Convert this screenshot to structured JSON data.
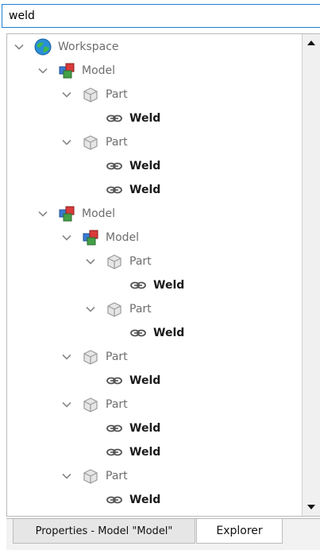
{
  "search": {
    "value": "weld"
  },
  "tabs": {
    "properties_label": "Properties - Model \"Model\"",
    "explorer_label": "Explorer"
  },
  "tree": [
    {
      "label": "Workspace",
      "type": "workspace",
      "depth": 0,
      "expandable": true
    },
    {
      "label": "Model",
      "type": "model",
      "depth": 1,
      "expandable": true
    },
    {
      "label": "Part",
      "type": "part",
      "depth": 2,
      "expandable": true
    },
    {
      "label": "Weld",
      "type": "weld",
      "depth": 3,
      "expandable": false
    },
    {
      "label": "Part",
      "type": "part",
      "depth": 2,
      "expandable": true
    },
    {
      "label": "Weld",
      "type": "weld",
      "depth": 3,
      "expandable": false
    },
    {
      "label": "Weld",
      "type": "weld",
      "depth": 3,
      "expandable": false
    },
    {
      "label": "Model",
      "type": "model",
      "depth": 1,
      "expandable": true
    },
    {
      "label": "Model",
      "type": "model",
      "depth": 2,
      "expandable": true
    },
    {
      "label": "Part",
      "type": "part",
      "depth": 3,
      "expandable": true
    },
    {
      "label": "Weld",
      "type": "weld",
      "depth": 4,
      "expandable": false
    },
    {
      "label": "Part",
      "type": "part",
      "depth": 3,
      "expandable": true
    },
    {
      "label": "Weld",
      "type": "weld",
      "depth": 4,
      "expandable": false
    },
    {
      "label": "Part",
      "type": "part",
      "depth": 2,
      "expandable": true
    },
    {
      "label": "Weld",
      "type": "weld",
      "depth": 3,
      "expandable": false
    },
    {
      "label": "Part",
      "type": "part",
      "depth": 2,
      "expandable": true
    },
    {
      "label": "Weld",
      "type": "weld",
      "depth": 3,
      "expandable": false
    },
    {
      "label": "Weld",
      "type": "weld",
      "depth": 3,
      "expandable": false
    },
    {
      "label": "Part",
      "type": "part",
      "depth": 2,
      "expandable": true
    },
    {
      "label": "Weld",
      "type": "weld",
      "depth": 3,
      "expandable": false
    }
  ]
}
